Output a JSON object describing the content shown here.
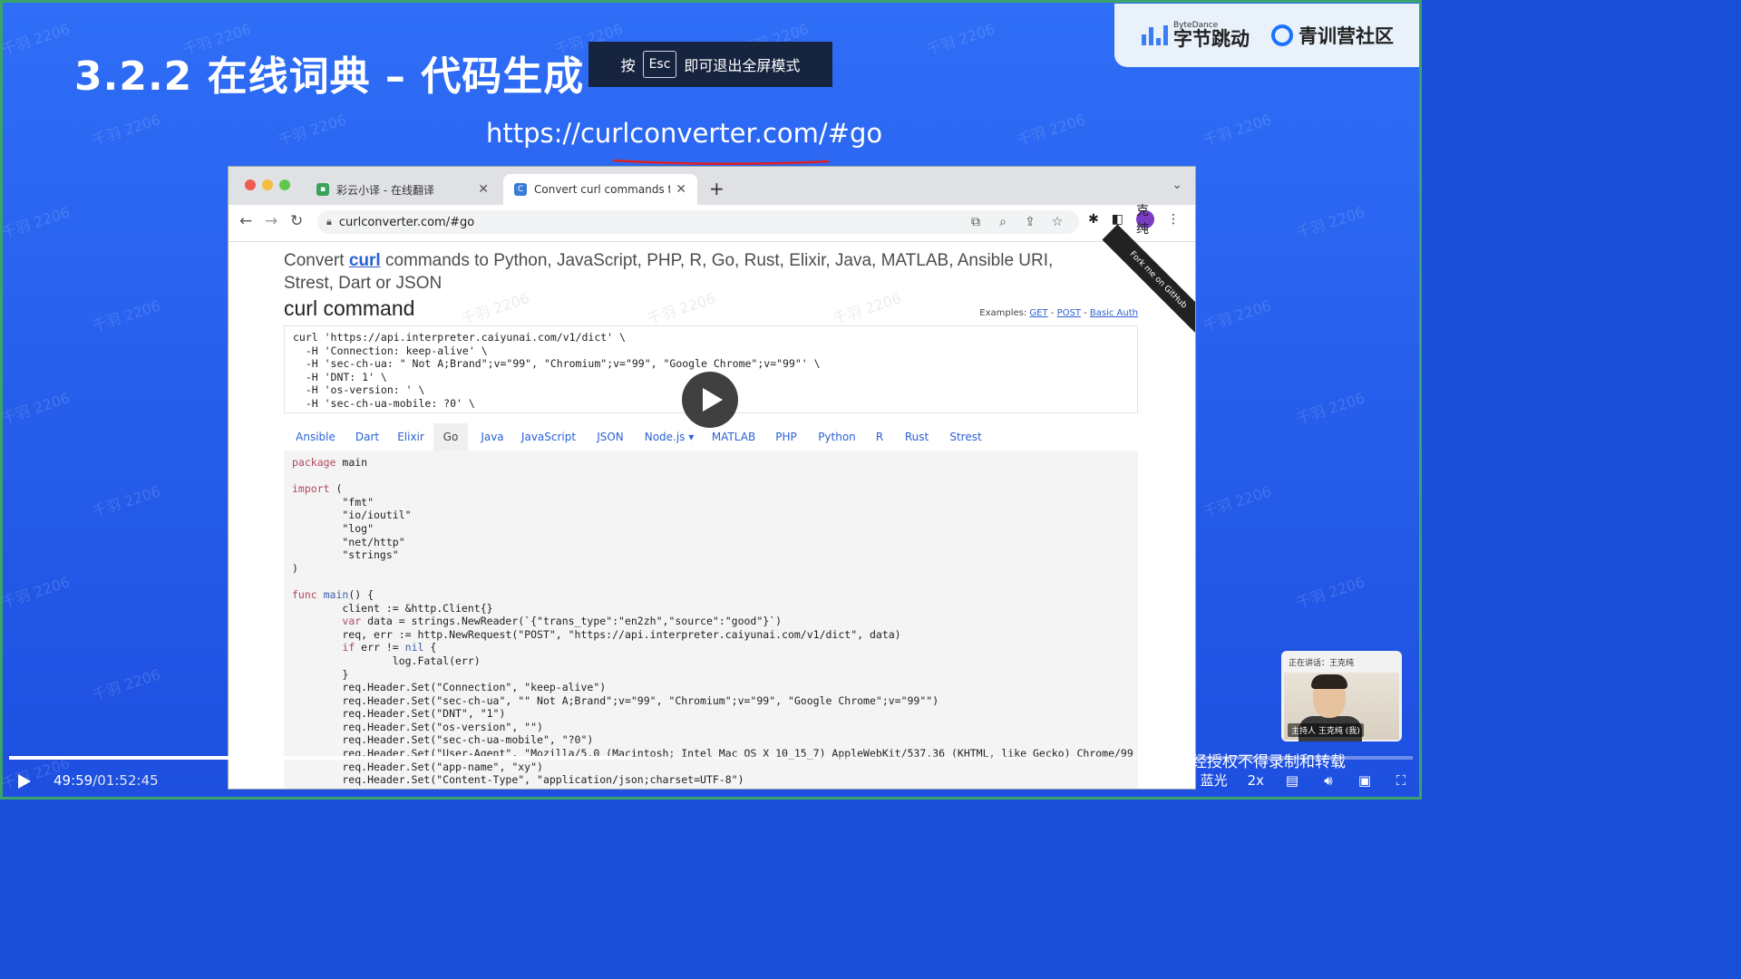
{
  "slide": {
    "title": "3.2.2 在线词典 – 代码生成",
    "url": "https://curlconverter.com/#go",
    "watermark": "千羽 2206",
    "esc_hint": {
      "prefix": "按",
      "key": "Esc",
      "suffix": "即可退出全屏模式"
    },
    "logos": {
      "bytedance_small": "ByteDance",
      "bytedance_big": "字节跳动",
      "community": "青训营社区"
    }
  },
  "browser": {
    "tabs": [
      {
        "title": "彩云小译 - 在线翻译",
        "active": false
      },
      {
        "title": "Convert curl commands to cod",
        "active": true
      }
    ],
    "address": "curlconverter.com/#go",
    "avatar_text": "克纯"
  },
  "page": {
    "heading_prefix": "Convert ",
    "heading_link": "curl",
    "heading_rest": " commands to Python, JavaScript, PHP, R, Go, Rust, Elixir, Java, MATLAB, Ansible URI, Strest, Dart or JSON",
    "fork_ribbon": "Fork me on GitHub",
    "section_title": "curl command",
    "examples": {
      "label": "Examples:",
      "get": "GET",
      "post": "POST",
      "basic_auth": "Basic Auth"
    },
    "curl_lines": [
      "curl 'https://api.interpreter.caiyunai.com/v1/dict' \\",
      "  -H 'Connection: keep-alive' \\",
      "  -H 'sec-ch-ua: \" Not A;Brand\";v=\"99\", \"Chromium\";v=\"99\", \"Google Chrome\";v=\"99\"' \\",
      "  -H 'DNT: 1' \\",
      "  -H 'os-version: ' \\",
      "  -H 'sec-ch-ua-mobile: ?0' \\"
    ],
    "lang_tabs": [
      "Ansible",
      "Dart",
      "Elixir",
      "Go",
      "Java",
      "JavaScript",
      "JSON",
      "Node.js ▾",
      "MATLAB",
      "PHP",
      "Python",
      "R",
      "Rust",
      "Strest"
    ],
    "active_tab": "Go",
    "code": {
      "l1_kw": "package",
      "l1_rest": " main",
      "l3_kw": "import",
      "l3_rest": " (",
      "imports": [
        "        \"fmt\"",
        "        \"io/ioutil\"",
        "        \"log\"",
        "        \"net/http\"",
        "        \"strings\""
      ],
      "close_paren": ")",
      "func_kw": "func",
      "func_name": " main",
      "func_rest": "() {",
      "client": "        client := &http.Client{}",
      "var_kw": "var",
      "var_rest": " data = strings.NewReader(`{\"trans_type\":\"en2zh\",\"source\":\"good\"}`)",
      "req": "        req, err := http.NewRequest(\"POST\", \"https://api.interpreter.caiyunai.com/v1/dict\", data)",
      "if_kw": "if",
      "if_mid": " err != ",
      "nil": "nil",
      "if_end": " {",
      "fatal": "                log.Fatal(err)",
      "close_brace": "        }",
      "headers": [
        "        req.Header.Set(\"Connection\", \"keep-alive\")",
        "        req.Header.Set(\"sec-ch-ua\", \"\" Not A;Brand\";v=\"99\", \"Chromium\";v=\"99\", \"Google Chrome\";v=\"99\"\")",
        "        req.Header.Set(\"DNT\", \"1\")",
        "        req.Header.Set(\"os-version\", \"\")",
        "        req.Header.Set(\"sec-ch-ua-mobile\", \"?0\")",
        "        req.Header.Set(\"User-Agent\", \"Mozilla/5.0 (Macintosh; Intel Mac OS X 10_15_7) AppleWebKit/537.36 (KHTML, like Gecko) Chrome/99",
        "        req.Header.Set(\"app-name\", \"xy\")",
        "        req.Header.Set(\"Content-Type\", \"application/json;charset=UTF-8\")"
      ]
    }
  },
  "speaker": {
    "label": "正在讲话：王克纯",
    "host_badge": "主持人",
    "name": "王克纯 (我)"
  },
  "player": {
    "current_time": "49:59",
    "total_time": "/01:52:45",
    "progress": 0.443,
    "notice": "经授权不得录制和转载",
    "quality": "蓝光",
    "speed": "2x"
  },
  "colors": {
    "slide_bg": "#2f6ef7",
    "link": "#2a60d4",
    "keyword": "#b0475e"
  }
}
